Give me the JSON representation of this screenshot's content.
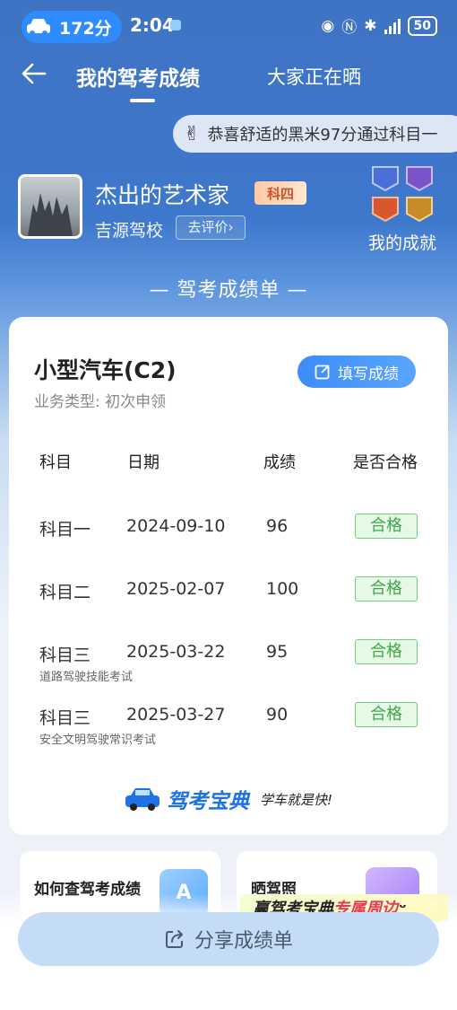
{
  "status_bar": {
    "badge_text": "172分",
    "time": "2:04",
    "battery": "50"
  },
  "nav": {
    "active_tab": "我的驾考成绩",
    "other_tab": "大家正在晒"
  },
  "banner": {
    "text": "恭喜舒适的黑米97分通过科目一"
  },
  "profile": {
    "name": "杰出的艺术家",
    "subject_badge": "科四",
    "school": "吉源驾校",
    "review_button": "去评价",
    "achievements_label": "我的成就"
  },
  "section_title": "— 驾考成绩单 —",
  "card": {
    "vehicle_type": "小型汽车(C2)",
    "business_type": "业务类型:  初次申领",
    "fill_button": "填写成绩",
    "columns": [
      "科目",
      "日期",
      "成绩",
      "是否合格"
    ],
    "rows": [
      {
        "subject": "科目一",
        "date": "2024-09-10",
        "score": "96",
        "result": "合格",
        "note": ""
      },
      {
        "subject": "科目二",
        "date": "2025-02-07",
        "score": "100",
        "result": "合格",
        "note": ""
      },
      {
        "subject": "科目三",
        "date": "2025-03-22",
        "score": "95",
        "result": "合格",
        "note": "道路驾驶技能考试"
      },
      {
        "subject": "科目三",
        "date": "2025-03-27",
        "score": "90",
        "result": "合格",
        "note": "安全文明驾驶常识考试"
      }
    ],
    "brand_name": "驾考宝典",
    "brand_slogan": "学车就是快!"
  },
  "bottom_cards": {
    "left_title": "如何查驾考成绩",
    "right_title": "晒驾照",
    "promo_prefix": "赢驾考宝典",
    "promo_highlight": "专属周边"
  },
  "share_button": "分享成绩单",
  "colors": {
    "primary": "#3e78cc",
    "button_blue": "#3d8cf7",
    "pass_green": "#3ea84a"
  }
}
